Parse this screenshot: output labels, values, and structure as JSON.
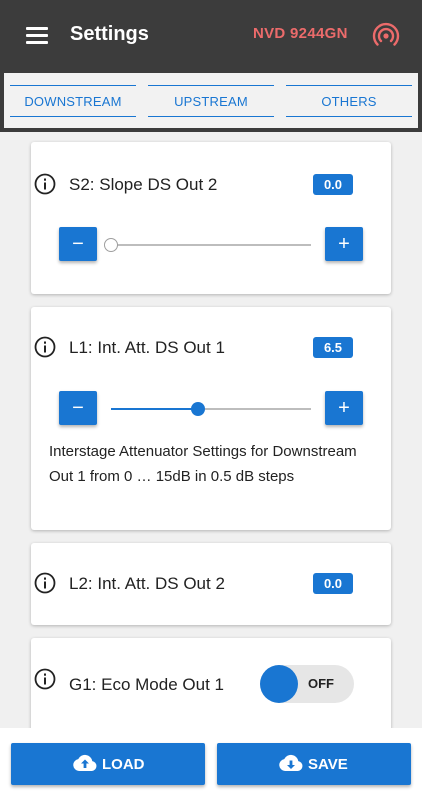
{
  "header": {
    "title": "Settings",
    "device_id": "NVD 9244GN",
    "menu_icon": "hamburger-menu-icon",
    "signal_icon": "wifi-signal-icon"
  },
  "tabs": [
    {
      "label": "DOWNSTREAM"
    },
    {
      "label": "UPSTREAM"
    },
    {
      "label": "OTHERS"
    }
  ],
  "settings": {
    "s2": {
      "label": "S2: Slope DS Out 2",
      "value": "0.0",
      "slider_fraction": 0.0
    },
    "l1": {
      "label": "L1: Int. Att. DS Out 1",
      "value": "6.5",
      "slider_fraction": 0.433,
      "description": "Interstage Attenuator Settings for Downstream Out 1 from 0 … 15dB in 0.5 dB steps"
    },
    "l2": {
      "label": "L2: Int. Att. DS Out 2",
      "value": "0.0"
    },
    "g1": {
      "label": "G1: Eco Mode Out 1",
      "toggle_text": "OFF"
    }
  },
  "controls": {
    "minus": "−",
    "plus": "+"
  },
  "actions": {
    "load_label": "LOAD",
    "save_label": "SAVE"
  },
  "colors": {
    "accent": "#1976d2",
    "appbar": "#3c3c3c",
    "device_id": "#ec6b6b"
  }
}
